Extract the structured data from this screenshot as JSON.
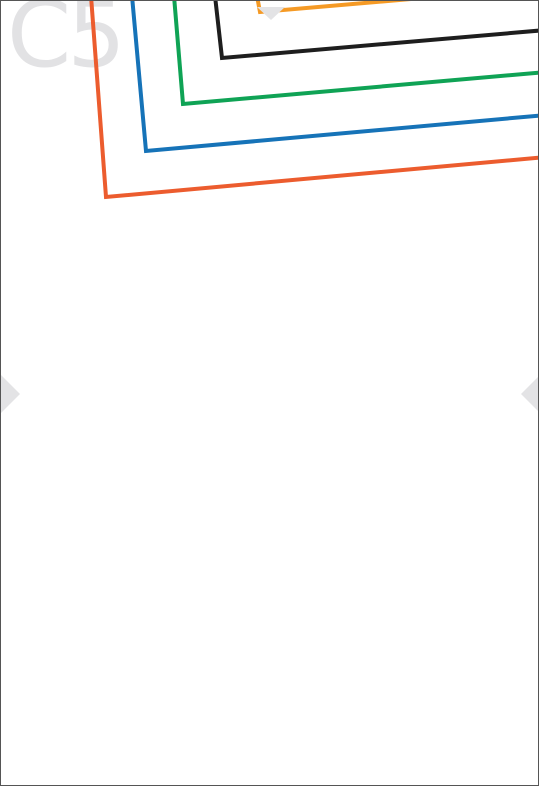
{
  "page": {
    "code_label": "C5"
  },
  "colors": {
    "watermark": "#e2e2e4",
    "marker": "#e3e3e5",
    "frames": [
      "#ec5c2e",
      "#1673b8",
      "#0fa355",
      "#1e1e1e",
      "#f59a25"
    ],
    "page_border": "#555555"
  },
  "frames": [
    {
      "name": "outer-frame",
      "color_index": 0
    },
    {
      "name": "second-frame",
      "color_index": 1
    },
    {
      "name": "third-frame",
      "color_index": 2
    },
    {
      "name": "fourth-frame",
      "color_index": 3
    },
    {
      "name": "inner-frame",
      "color_index": 4
    }
  ],
  "markers": [
    "left-marker",
    "right-marker",
    "top-marker"
  ]
}
